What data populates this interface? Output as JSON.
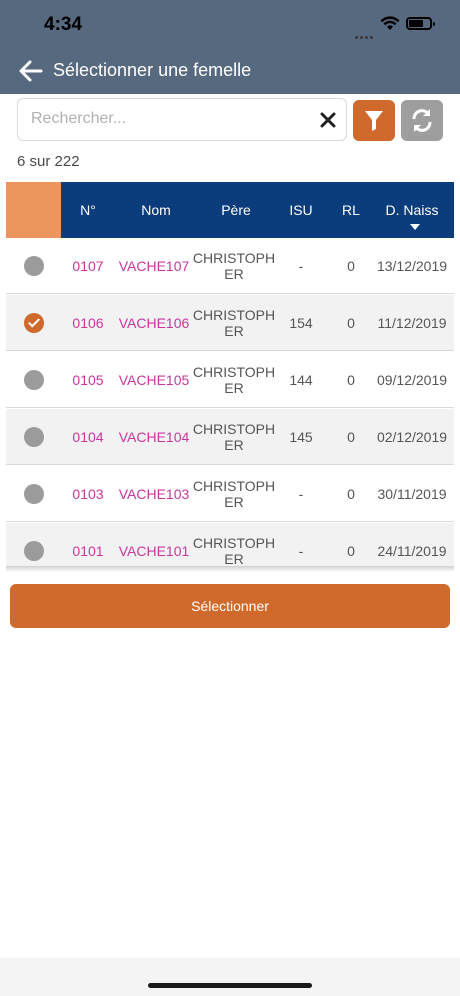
{
  "status_bar": {
    "time": "4:34"
  },
  "header": {
    "title": "Sélectionner  une femelle",
    "back_icon": "arrow-left-icon"
  },
  "search": {
    "placeholder": "Rechercher...",
    "value": ""
  },
  "result_count": "6 sur 222",
  "colors": {
    "header_bg": "#57697f",
    "accent": "#cf6a2c",
    "table_header": "#0b3c7c",
    "select_col": "#ec955f",
    "link_pink": "#c8379d"
  },
  "table": {
    "headers": {
      "num": "N°",
      "nom": "Nom",
      "pere": "Père",
      "isu": "ISU",
      "rl": "RL",
      "date": "D. Naiss"
    },
    "sort": {
      "column": "date",
      "direction": "desc"
    },
    "rows": [
      {
        "selected": false,
        "num": "0107",
        "nom": "VACHE107",
        "pere_l1": "CHRISTOPH",
        "pere_l2": "ER",
        "isu": "-",
        "rl": "0",
        "date": "13/12/2019"
      },
      {
        "selected": true,
        "num": "0106",
        "nom": "VACHE106",
        "pere_l1": "CHRISTOPH",
        "pere_l2": "ER",
        "isu": "154",
        "rl": "0",
        "date": "11/12/2019"
      },
      {
        "selected": false,
        "num": "0105",
        "nom": "VACHE105",
        "pere_l1": "CHRISTOPH",
        "pere_l2": "ER",
        "isu": "144",
        "rl": "0",
        "date": "09/12/2019"
      },
      {
        "selected": false,
        "num": "0104",
        "nom": "VACHE104",
        "pere_l1": "CHRISTOPH",
        "pere_l2": "ER",
        "isu": "145",
        "rl": "0",
        "date": "02/12/2019"
      },
      {
        "selected": false,
        "num": "0103",
        "nom": "VACHE103",
        "pere_l1": "CHRISTOPH",
        "pere_l2": "ER",
        "isu": "-",
        "rl": "0",
        "date": "30/11/2019"
      },
      {
        "selected": false,
        "num": "0101",
        "nom": "VACHE101",
        "pere_l1": "CHRISTOPH",
        "pere_l2": "ER",
        "isu": "-",
        "rl": "0",
        "date": "24/11/2019"
      }
    ]
  },
  "select_button": {
    "label": "Sélectionner"
  }
}
